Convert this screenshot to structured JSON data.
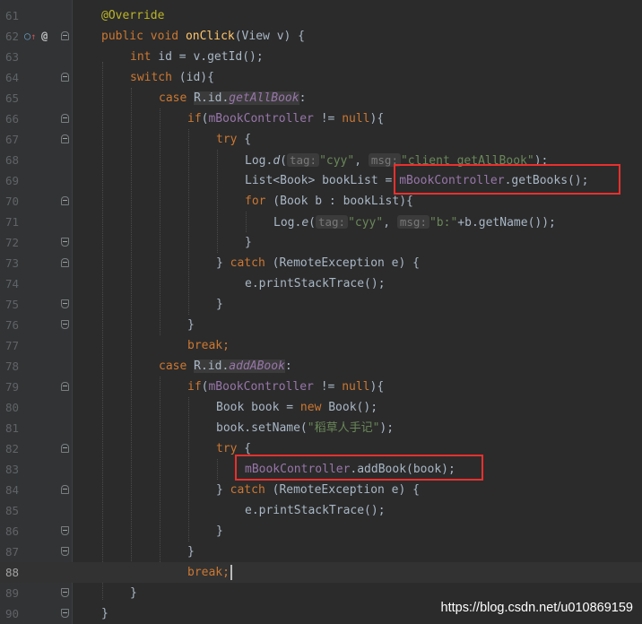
{
  "watermark": "https://blog.csdn.net/u010869159",
  "gutter_icons": {
    "implement": "implement-up-arrow-icon",
    "override_mark": "@"
  },
  "line_numbers": [
    "61",
    "62",
    "63",
    "64",
    "65",
    "66",
    "67",
    "68",
    "69",
    "70",
    "71",
    "72",
    "73",
    "74",
    "75",
    "76",
    "77",
    "78",
    "79",
    "80",
    "81",
    "82",
    "83",
    "84",
    "85",
    "86",
    "87",
    "88",
    "89",
    "90"
  ],
  "current_line": "88",
  "code": {
    "l61": {
      "override": "@Override"
    },
    "l62": {
      "public": "public",
      "void": "void",
      "method": "onClick",
      "params": "(View v) {"
    },
    "l63": {
      "int": "int",
      "rest": " id = v.getId();"
    },
    "l64": {
      "switch": "switch",
      "rest": " (id){"
    },
    "l65": {
      "case": "case",
      "r_id": "R.id.",
      "const": "getAllBook",
      "colon": ":"
    },
    "l66": {
      "if": "if",
      "open": "(",
      "field": "mBookController",
      "ne": " != ",
      "null": "null",
      "close": "){"
    },
    "l67": {
      "try": "try",
      "brace": " {"
    },
    "l68": {
      "call": "Log.",
      "method": "d",
      "open": "(",
      "tag_hint": "tag:",
      "tag_val": "\"cyy\"",
      "comma": ", ",
      "msg_hint": "msg:",
      "msg_val": "\"client getAllBook\"",
      "end": ");"
    },
    "l69": {
      "lhs": "List<Book> bookList = ",
      "field": "mBookController",
      "call": ".getBooks();"
    },
    "l70": {
      "for": "for",
      "rest": " (Book b : bookList){"
    },
    "l71": {
      "call": "Log.",
      "method": "e",
      "open": "(",
      "tag_hint": "tag:",
      "tag_val": "\"cyy\"",
      "comma": ", ",
      "msg_hint": "msg:",
      "msg_val": "\"b:\"",
      "rest": "+b.getName());"
    },
    "l72": {
      "brace": "}"
    },
    "l73": {
      "open": "} ",
      "catch": "catch",
      "rest": " (RemoteException e) {"
    },
    "l74": {
      "text": "e.printStackTrace();"
    },
    "l75": {
      "brace": "}"
    },
    "l76": {
      "brace": "}"
    },
    "l77": {
      "break": "break",
      "semi": ";"
    },
    "l78": {
      "case": "case",
      "r_id": "R.id.",
      "const": "addABook",
      "colon": ":"
    },
    "l79": {
      "if": "if",
      "open": "(",
      "field": "mBookController",
      "ne": " != ",
      "null": "null",
      "close": "){"
    },
    "l80": {
      "lhs": "Book book = ",
      "new": "new",
      "rest": " Book();"
    },
    "l81": {
      "call": "book.setName(",
      "str": "\"稻草人手记\"",
      "end": ");"
    },
    "l82": {
      "try": "try",
      "brace": " {"
    },
    "l83": {
      "field": "mBookController",
      "call": ".addBook(book);"
    },
    "l84": {
      "open": "} ",
      "catch": "catch",
      "rest": " (RemoteException e) {"
    },
    "l85": {
      "text": "e.printStackTrace();"
    },
    "l86": {
      "brace": "}"
    },
    "l87": {
      "brace": "}"
    },
    "l88": {
      "break": "break",
      "semi": ";"
    },
    "l89": {
      "brace": "}"
    },
    "l90": {
      "brace": "}"
    }
  }
}
